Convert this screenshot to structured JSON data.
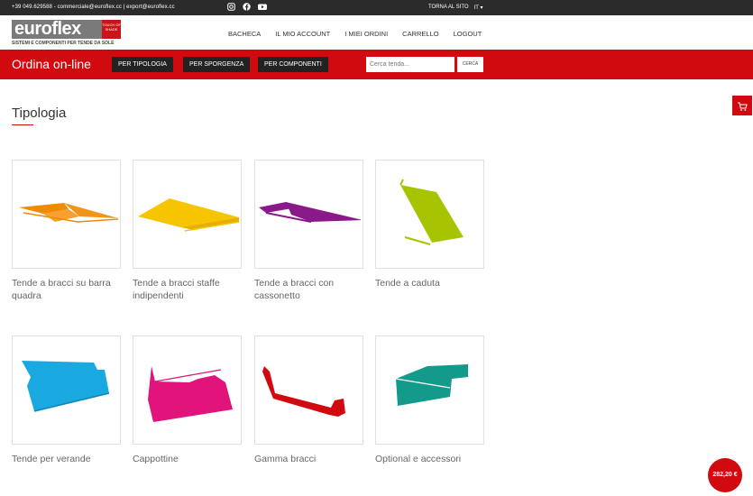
{
  "topbar": {
    "contact": "+39 049.629588 - commerciale@euroflex.cc | export@euroflex.cc",
    "back_to_site": "TORNA AL SITO",
    "lang": "IT ▾"
  },
  "header": {
    "logo_word": "euroflex",
    "logo_badge": "TOUCH OF SHADE",
    "logo_tagline": "SISTEMI E COMPONENTI PER TENDE DA SOLE",
    "nav": [
      "BACHECA",
      "IL MIO ACCOUNT",
      "I MIEI ORDINI",
      "CARRELLO",
      "LOGOUT"
    ]
  },
  "orderbar": {
    "title": "Ordina on-line",
    "buttons": [
      "PER TIPOLOGIA",
      "PER SPORGENZA",
      "PER COMPONENTI"
    ],
    "search_placeholder": "Cerca tenda...",
    "search_button": "CERCA"
  },
  "section": {
    "title": "Tipologia"
  },
  "categories": [
    {
      "label": "Tende a bracci su barra quadra",
      "color": "#f08a00"
    },
    {
      "label": "Tende a bracci staffe indipendenti",
      "color": "#f7c500"
    },
    {
      "label": "Tende a bracci con cassonetto",
      "color": "#8a1a8a"
    },
    {
      "label": "Tende a caduta",
      "color": "#a8c400"
    },
    {
      "label": "Tende per verande",
      "color": "#19a8e0"
    },
    {
      "label": "Cappottine",
      "color": "#e0147a"
    },
    {
      "label": "Gamma bracci",
      "color": "#d10a10"
    },
    {
      "label": "Optional e accessori",
      "color": "#149a8a"
    }
  ],
  "cart_total": "282,20 €",
  "colors": {
    "accent": "#d10a10",
    "topbar": "#2b2b2b"
  }
}
